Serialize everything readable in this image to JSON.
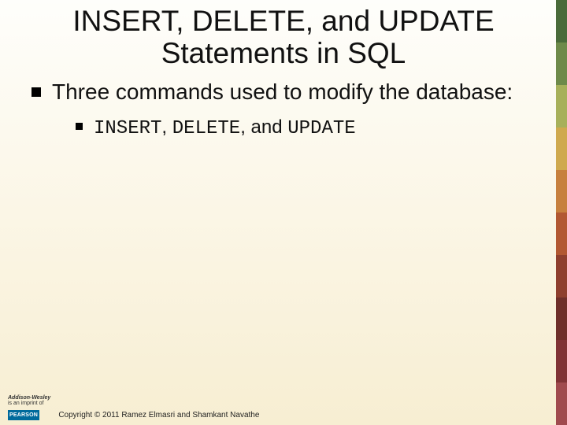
{
  "title": "INSERT, DELETE, and UPDATE Statements in SQL",
  "bullets": {
    "lvl1": "Three commands used to modify the database:",
    "lvl2_parts": {
      "a": "INSERT",
      "b": ", ",
      "c": "DELETE",
      "d": ", and ",
      "e": "UPDATE"
    }
  },
  "footer": {
    "imprint_line1": "Addison-Wesley",
    "imprint_line2": "is an imprint of",
    "pearson": "PEARSON",
    "copyright": "Copyright © 2011 Ramez Elmasri and Shamkant Navathe"
  },
  "sidebar_colors": [
    "#4a6b3a",
    "#6e8a4a",
    "#a7b05a",
    "#cfa94e",
    "#c7803e",
    "#b25832",
    "#8e3f2e",
    "#6e2f2a",
    "#803336",
    "#a04a4e"
  ]
}
